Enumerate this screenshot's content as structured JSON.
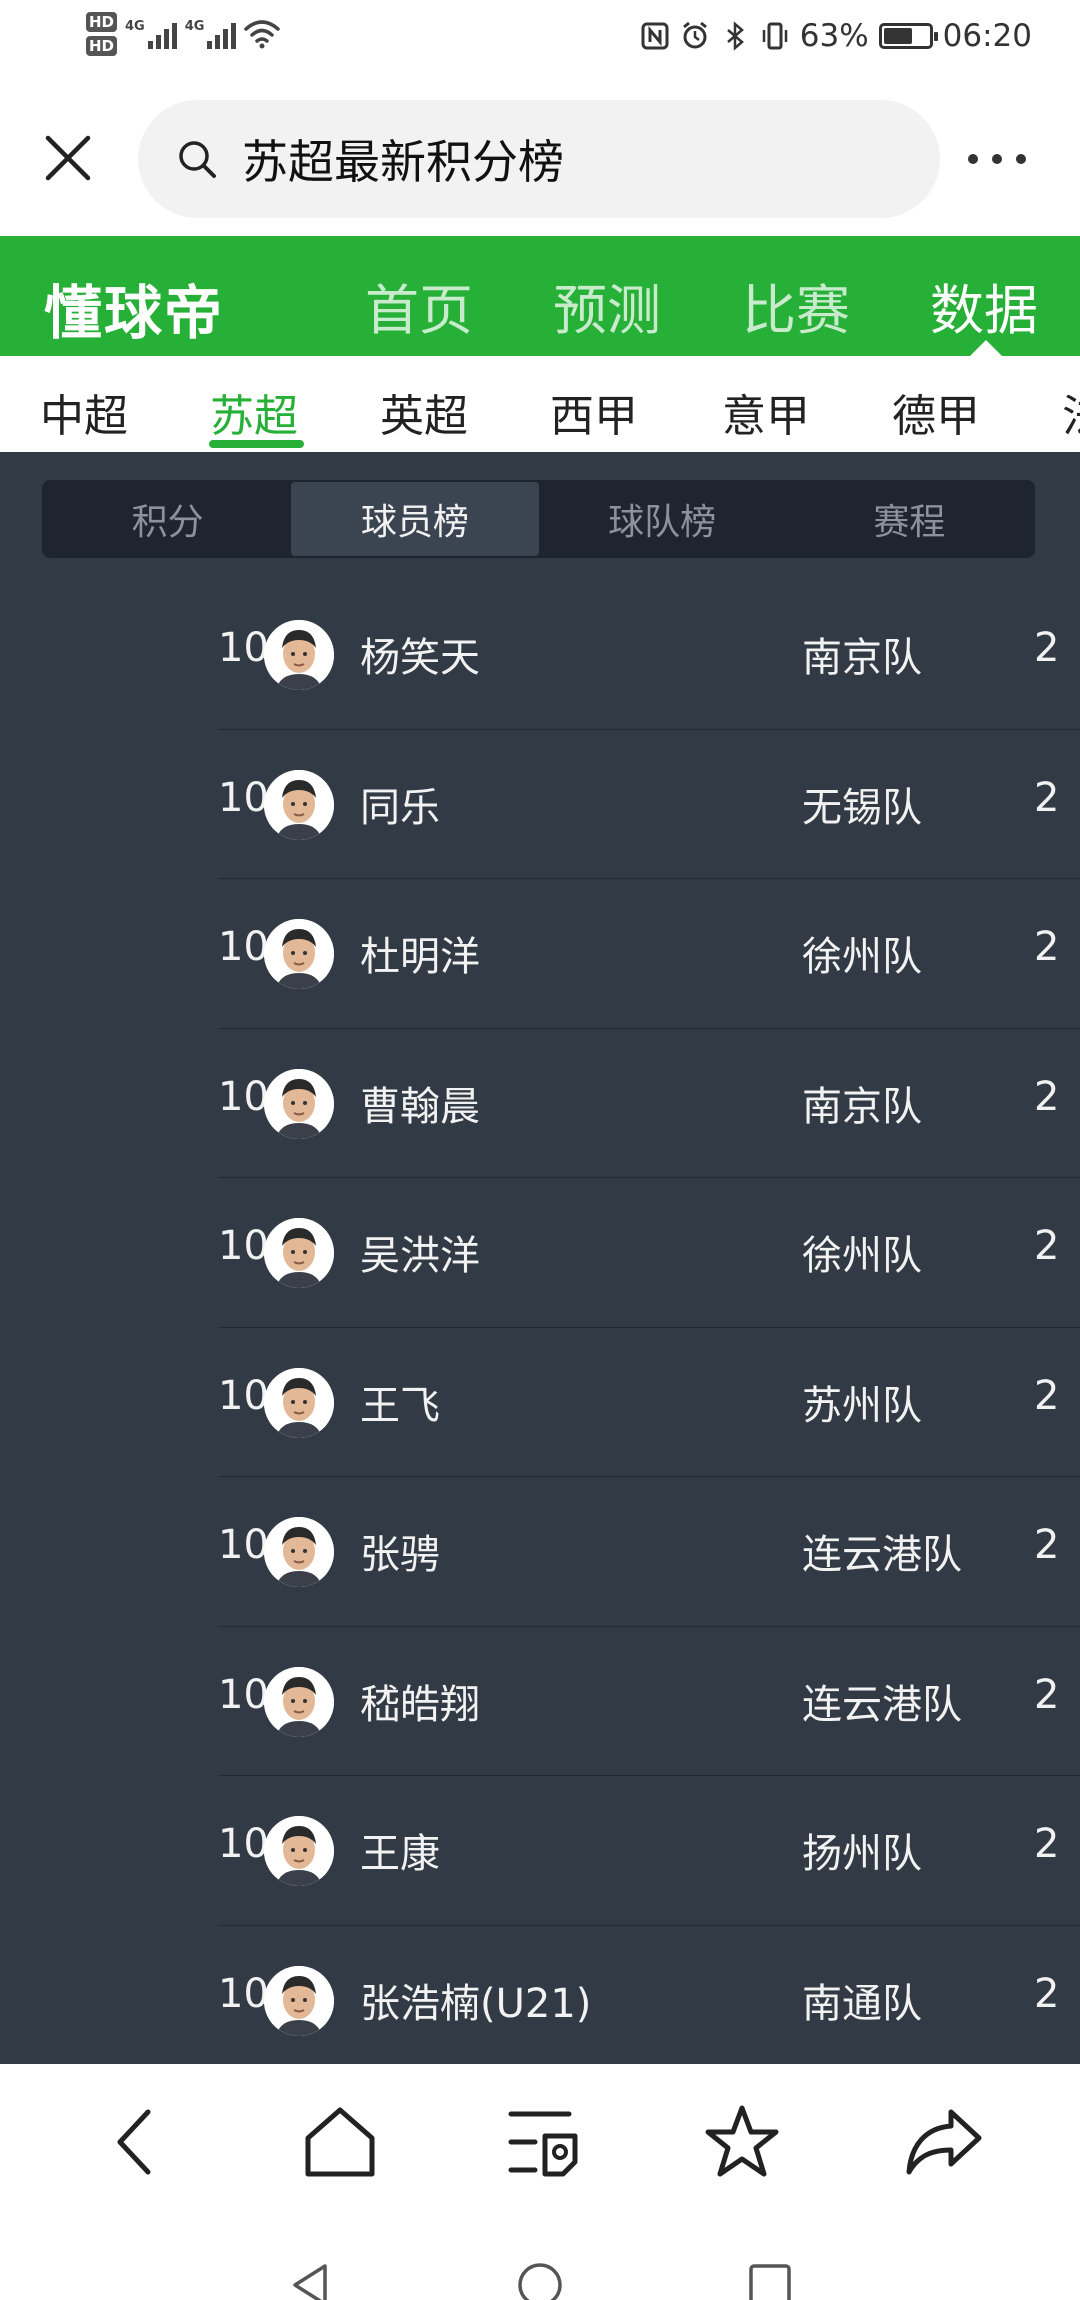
{
  "status_bar": {
    "hd1": "HD",
    "hd2": "HD",
    "net1": "4G",
    "net2": "4G",
    "battery_text": "63%",
    "battery_level": 0.63,
    "time": "06:20"
  },
  "search": {
    "query": "苏超最新积分榜"
  },
  "topnav": {
    "brand": "懂球帝",
    "tabs": [
      {
        "label": "首页"
      },
      {
        "label": "预测"
      },
      {
        "label": "比赛"
      },
      {
        "label": "数据"
      }
    ],
    "active_index": 3
  },
  "leagues": {
    "tabs": [
      {
        "label": "中超"
      },
      {
        "label": "苏超"
      },
      {
        "label": "英超"
      },
      {
        "label": "西甲"
      },
      {
        "label": "意甲"
      },
      {
        "label": "德甲"
      },
      {
        "label": "法甲"
      }
    ],
    "active_index": 1
  },
  "segments": {
    "items": [
      {
        "label": "积分"
      },
      {
        "label": "球员榜"
      },
      {
        "label": "球队榜"
      },
      {
        "label": "赛程"
      }
    ],
    "active_index": 1
  },
  "players": [
    {
      "rank": "10",
      "name": "杨笑天",
      "team": "南京队",
      "goals": "2"
    },
    {
      "rank": "10",
      "name": "同乐",
      "team": "无锡队",
      "goals": "2"
    },
    {
      "rank": "10",
      "name": "杜明洋",
      "team": "徐州队",
      "goals": "2"
    },
    {
      "rank": "10",
      "name": "曹翰晨",
      "team": "南京队",
      "goals": "2"
    },
    {
      "rank": "10",
      "name": "吴洪洋",
      "team": "徐州队",
      "goals": "2"
    },
    {
      "rank": "10",
      "name": "王飞",
      "team": "苏州队",
      "goals": "2"
    },
    {
      "rank": "10",
      "name": "张骋",
      "team": "连云港队",
      "goals": "2"
    },
    {
      "rank": "10",
      "name": "嵇皓翔",
      "team": "连云港队",
      "goals": "2"
    },
    {
      "rank": "10",
      "name": "王康",
      "team": "扬州队",
      "goals": "2"
    },
    {
      "rank": "10",
      "name": "张浩楠(U21)",
      "team": "南通队",
      "goals": "2"
    }
  ],
  "toolbar": {
    "icons": [
      "back-icon",
      "home-icon",
      "tabs-list-icon",
      "star-icon",
      "share-icon"
    ]
  },
  "colors": {
    "brand_green": "#27b037",
    "content_bg": "#323a45",
    "segment_bg": "#1f252e"
  }
}
